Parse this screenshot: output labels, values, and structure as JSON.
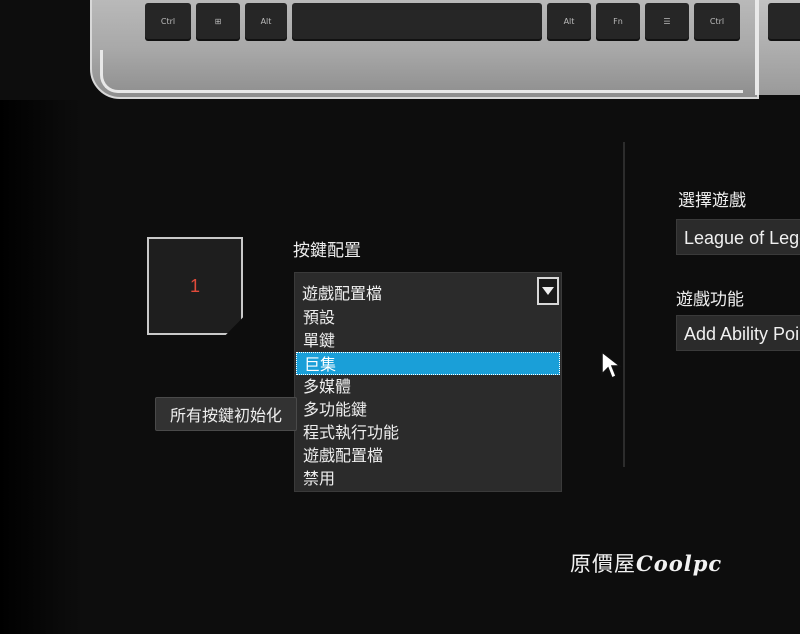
{
  "keyboard": {
    "keys": [
      "Ctrl",
      "⊞",
      "Alt",
      "",
      "Alt",
      "Fn",
      "☰",
      "Ctrl"
    ]
  },
  "key_panel": {
    "selected_key_number": "1",
    "reset_all_label": "所有按鍵初始化"
  },
  "key_config": {
    "label": "按鍵配置",
    "current_value": "遊戲配置檔",
    "options": [
      "預設",
      "單鍵",
      "巨集",
      "多媒體",
      "多功能鍵",
      "程式執行功能",
      "遊戲配置檔",
      "禁用"
    ],
    "highlighted_option": "巨集"
  },
  "right_panel": {
    "select_game_label": "選擇遊戲",
    "select_game_value": "League of Legends",
    "game_function_label": "遊戲功能",
    "game_function_value": "Add Ability Points"
  },
  "watermark": {
    "text_cn": "原價屋",
    "brand": "Coolpc"
  },
  "colors": {
    "highlight": "#1a9fd8",
    "key_number": "#e04a3a",
    "background": "#0d0d0d"
  }
}
